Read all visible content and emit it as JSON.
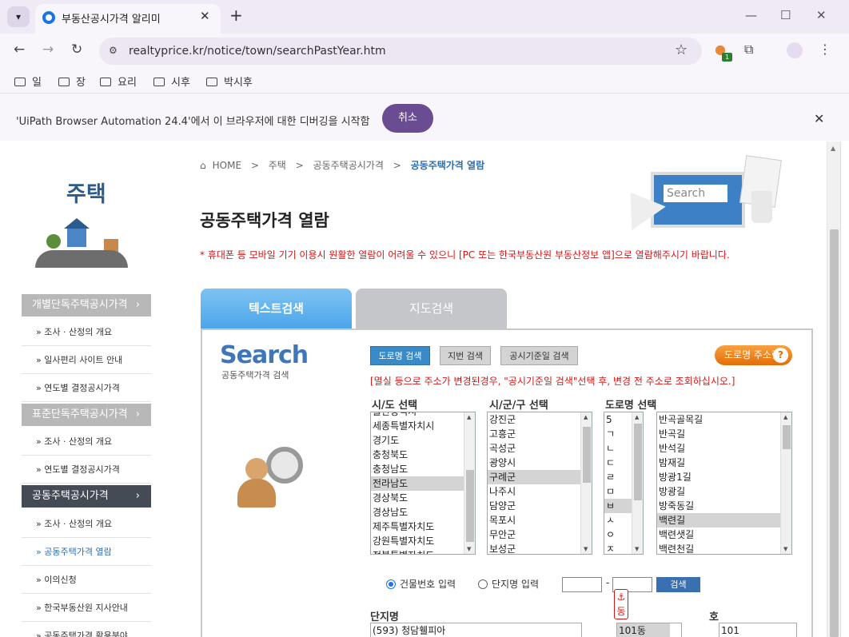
{
  "browser": {
    "tab_title": "부동산공시가격 알리미",
    "url": "realtyprice.kr/notice/town/searchPastYear.htm",
    "bookmarks": [
      "일",
      "장",
      "요리",
      "시후",
      "박시후"
    ],
    "infobar_message": "'UiPath Browser Automation 24.4'에서 이 브라우저에 대한 디버깅을 시작함",
    "infobar_cancel": "취소",
    "ext_badge": "1"
  },
  "sidebar": {
    "title": "주택",
    "categories": [
      {
        "label": "개별단독주택공시가격",
        "items": [
          "조사 · 산정의 개요",
          "일사편리 사이트 안내",
          "연도별 결정공시가격"
        ]
      },
      {
        "label": "표준단독주택공시가격",
        "items": [
          "조사 · 산정의 개요",
          "연도별 결정공시가격"
        ]
      },
      {
        "label": "공동주택공시가격",
        "items": [
          "조사 · 산정의 개요",
          "공동주택가격 열람",
          "이의신청",
          "한국부동산원 지사안내",
          "공동주택가격 활용분야"
        ]
      }
    ],
    "arrow": "›"
  },
  "breadcrumb": {
    "home": "HOME",
    "sep": ">",
    "items": [
      "주택",
      "공동주택공시가격"
    ],
    "current": "공동주택가격 열람"
  },
  "page": {
    "title": "공동주택가격 열람",
    "notice": "* 휴대폰 등 모바일 기기 이용시 원활한 열람이 어려울 수 있으니 [PC 또는 한국부동산원 부동산정보 앱]으로 열람해주시기 바랍니다.",
    "hero_search_text": "Search"
  },
  "tabs": {
    "text_search": "텍스트검색",
    "map_search": "지도검색"
  },
  "search": {
    "logo": "Search",
    "logo_sub": "공동주택가격 검색",
    "modes": [
      "도로명 검색",
      "지번 검색",
      "공시기준일 검색"
    ],
    "road_address_button": "도로명 주소란",
    "road_q": "?",
    "hint": "[멸실 등으로 주소가 변경된경우, \"공시기준일 검색\"선택 후, 변경 전 주소로 조회하십시오.]",
    "labels": {
      "sido": "시/도 선택",
      "sigungu": "시/군/구 선택",
      "road": "도로명 선택"
    },
    "sido_items": [
      "울산광역시",
      "세종특별자치시",
      "경기도",
      "충청북도",
      "충청남도",
      "전라남도",
      "경상북도",
      "경상남도",
      "제주특별자치도",
      "강원특별자치도",
      "전북특별자치도"
    ],
    "sido_selected": "전라남도",
    "sigungu_items": [
      "강진군",
      "고흥군",
      "곡성군",
      "광양시",
      "구례군",
      "나주시",
      "담양군",
      "목포시",
      "무안군",
      "보성군"
    ],
    "sigungu_selected": "구례군",
    "initial_items": [
      "5",
      "ㄱ",
      "ㄴ",
      "ㄷ",
      "ㄹ",
      "ㅁ",
      "ㅂ",
      "ㅅ",
      "ㅇ",
      "ㅈ"
    ],
    "initial_selected": "ㅂ",
    "road_items": [
      "반곡골목길",
      "반곡길",
      "반석길",
      "밤재길",
      "방광1길",
      "방광길",
      "방죽동길",
      "백련길",
      "백련샛길",
      "백련천길"
    ],
    "road_selected": "백련길",
    "radio_building": "건물번호 입력",
    "radio_complex": "단지명 입력",
    "dash": "-",
    "go": "검색",
    "anchor_icon": "⚓",
    "dong_label": "동",
    "complex_label": "단지명",
    "ho_label": "호",
    "complex_items": [
      "(593) 청담휄피아"
    ],
    "dong_items": [
      "101동"
    ],
    "ho_items": [
      "101"
    ]
  }
}
